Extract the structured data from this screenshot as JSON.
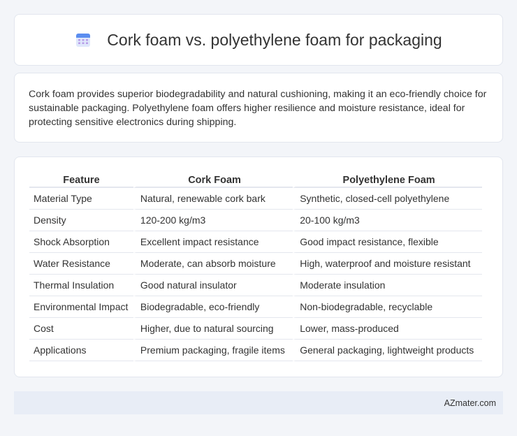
{
  "header": {
    "title": "Cork foam vs. polyethylene foam for packaging"
  },
  "summary": {
    "text": "Cork foam provides superior biodegradability and natural cushioning, making it an eco-friendly choice for sustainable packaging. Polyethylene foam offers higher resilience and moisture resistance, ideal for protecting sensitive electronics during shipping."
  },
  "table": {
    "headers": [
      "Feature",
      "Cork Foam",
      "Polyethylene Foam"
    ],
    "rows": [
      [
        "Material Type",
        "Natural, renewable cork bark",
        "Synthetic, closed-cell polyethylene"
      ],
      [
        "Density",
        "120-200 kg/m3",
        "20-100 kg/m3"
      ],
      [
        "Shock Absorption",
        "Excellent impact resistance",
        "Good impact resistance, flexible"
      ],
      [
        "Water Resistance",
        "Moderate, can absorb moisture",
        "High, waterproof and moisture resistant"
      ],
      [
        "Thermal Insulation",
        "Good natural insulator",
        "Moderate insulation"
      ],
      [
        "Environmental Impact",
        "Biodegradable, eco-friendly",
        "Non-biodegradable, recyclable"
      ],
      [
        "Cost",
        "Higher, due to natural sourcing",
        "Lower, mass-produced"
      ],
      [
        "Applications",
        "Premium packaging, fragile items",
        "General packaging, lightweight products"
      ]
    ]
  },
  "footer": {
    "brand": "AZmater.com"
  },
  "icons": {
    "title_icon": "calendar-icon"
  },
  "colors": {
    "background": "#f3f5f9",
    "footer_bg": "#e8edf6",
    "icon_blue": "#5b8def",
    "icon_purple": "#b79be8"
  }
}
